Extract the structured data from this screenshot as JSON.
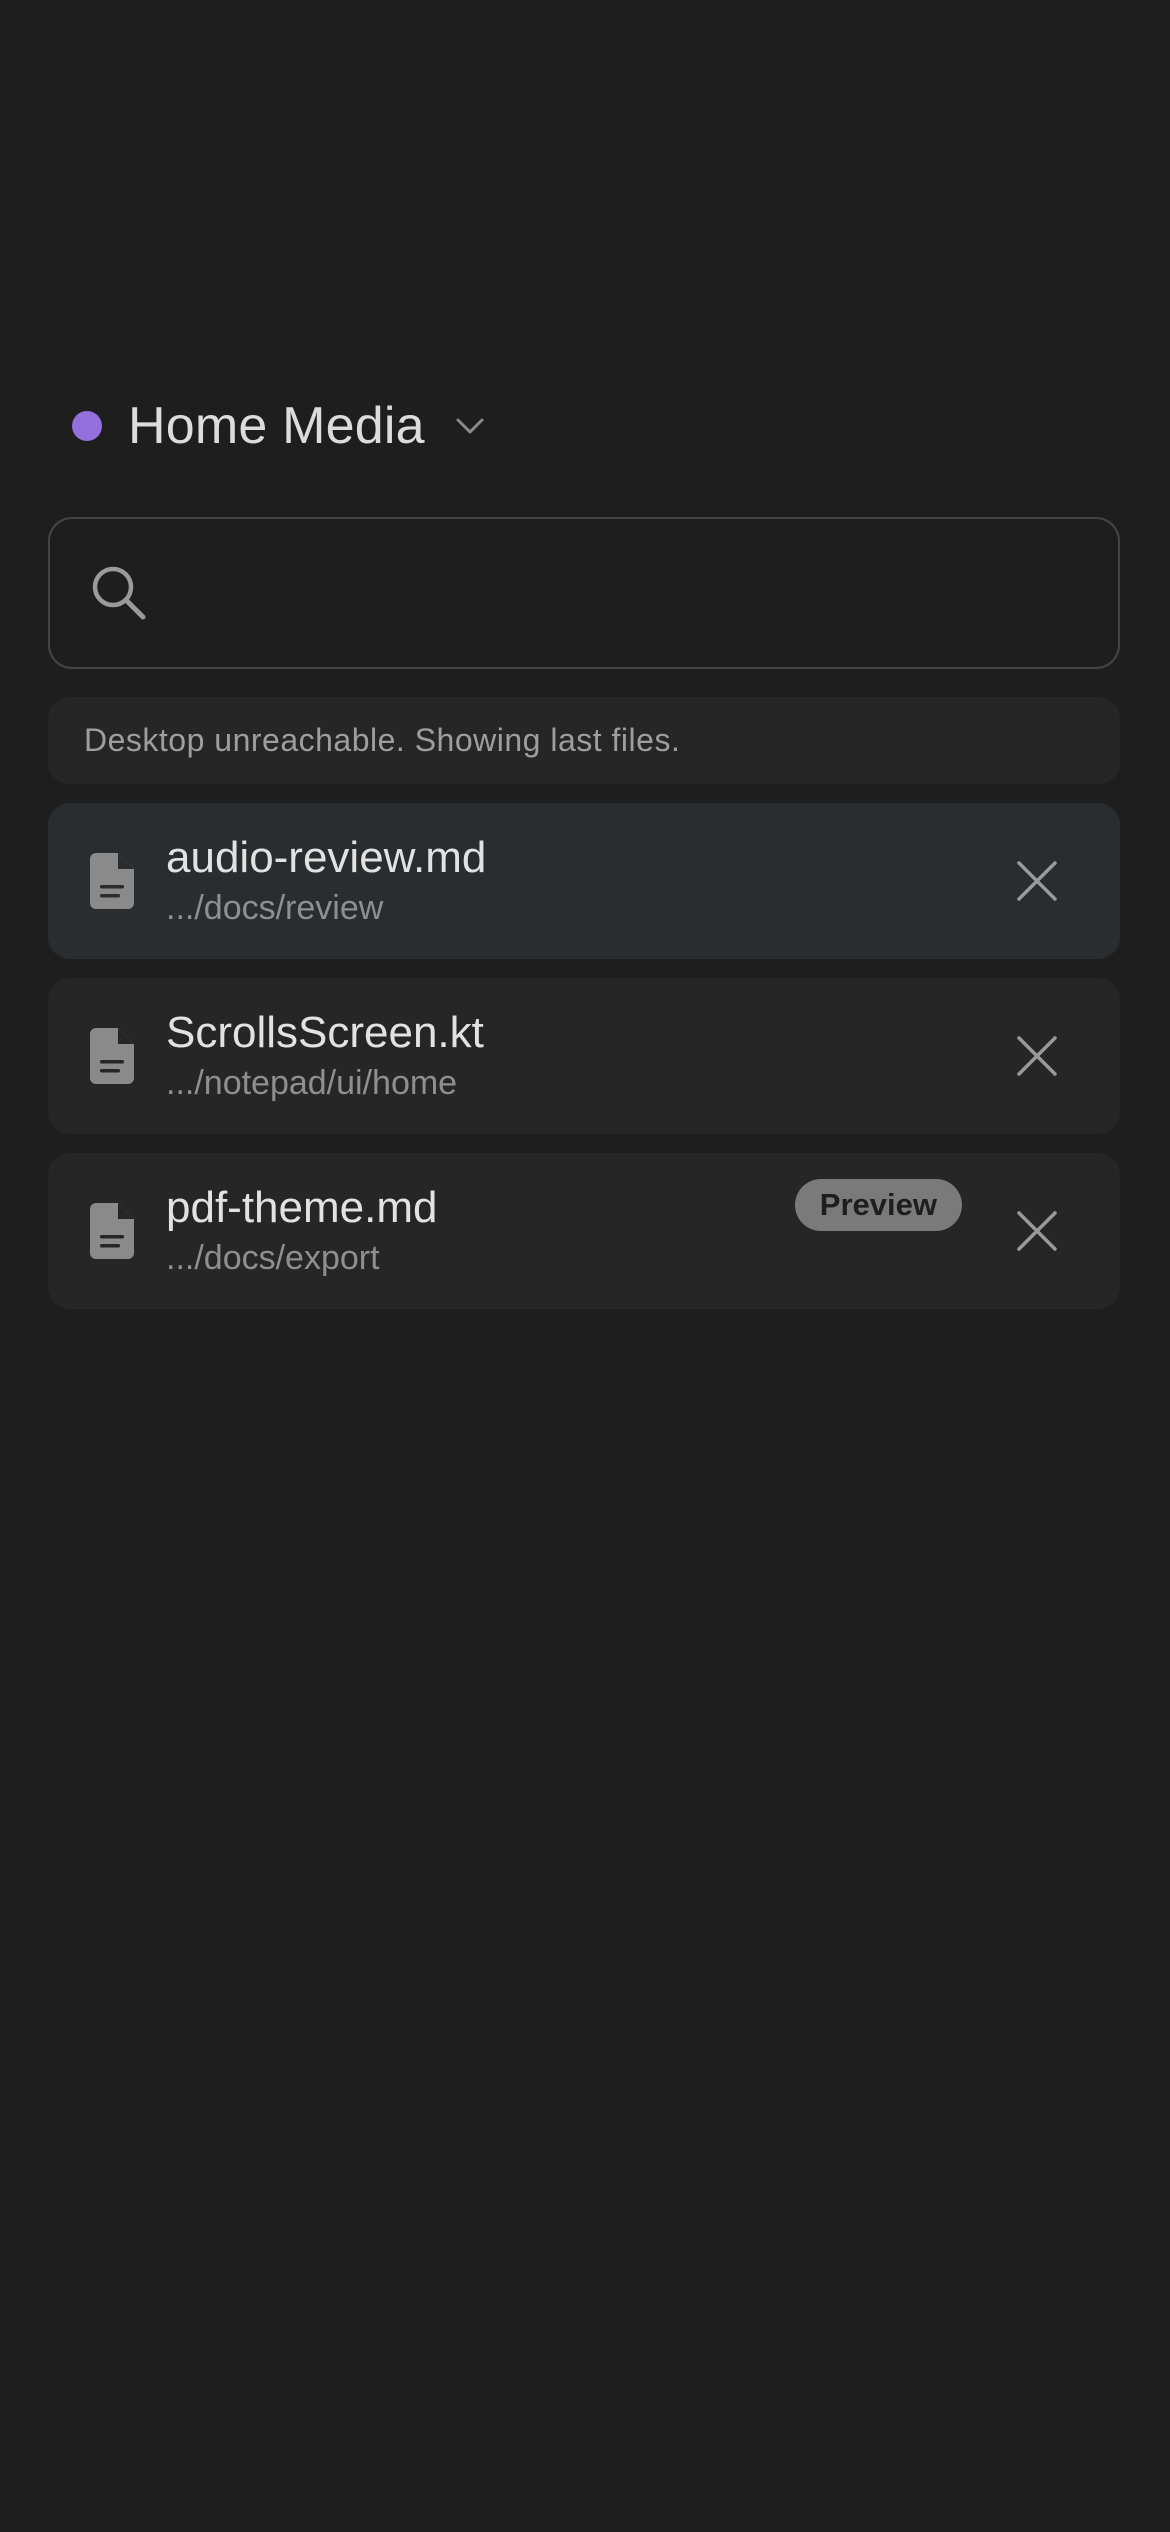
{
  "header": {
    "device_name": "Home Media",
    "status_color": "#9370db"
  },
  "search": {
    "value": "",
    "placeholder": ""
  },
  "banner": {
    "text": "Desktop unreachable. Showing last files."
  },
  "files": [
    {
      "name": "audio-review.md",
      "path": ".../docs/review",
      "active": true,
      "badge": ""
    },
    {
      "name": "ScrollsScreen.kt",
      "path": ".../notepad/ui/home",
      "active": false,
      "badge": ""
    },
    {
      "name": "pdf-theme.md",
      "path": ".../docs/export",
      "active": false,
      "badge": "Preview"
    }
  ],
  "icons": {
    "status": "status-dot",
    "dropdown": "chevron-down-icon",
    "search": "search-icon",
    "file": "file-icon",
    "close": "close-icon"
  }
}
